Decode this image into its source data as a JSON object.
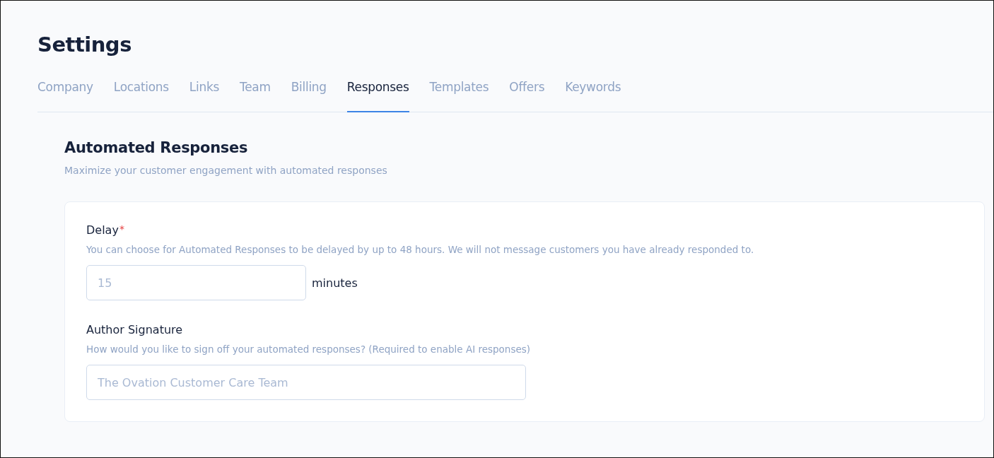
{
  "page": {
    "title": "Settings"
  },
  "tabs": [
    {
      "label": "Company",
      "selected": false
    },
    {
      "label": "Locations",
      "selected": false
    },
    {
      "label": "Links",
      "selected": false
    },
    {
      "label": "Team",
      "selected": false
    },
    {
      "label": "Billing",
      "selected": false
    },
    {
      "label": "Responses",
      "selected": true
    },
    {
      "label": "Templates",
      "selected": false
    },
    {
      "label": "Offers",
      "selected": false
    },
    {
      "label": "Keywords",
      "selected": false
    }
  ],
  "section": {
    "title": "Automated Responses",
    "subtitle": "Maximize your customer engagement with automated responses"
  },
  "fields": [
    {
      "label": "Delay",
      "required_mark": "*",
      "hint": "You can choose for Automated Responses to be delayed by up to 48 hours. We will not message customers you have already responded to.",
      "placeholder": "15",
      "unit": "minutes",
      "kind": "short"
    },
    {
      "label": "Author Signature",
      "hint": "How would you like to sign off your automated responses? (Required to enable AI responses)",
      "placeholder": "The Ovation Customer Care Team",
      "kind": "long"
    }
  ]
}
